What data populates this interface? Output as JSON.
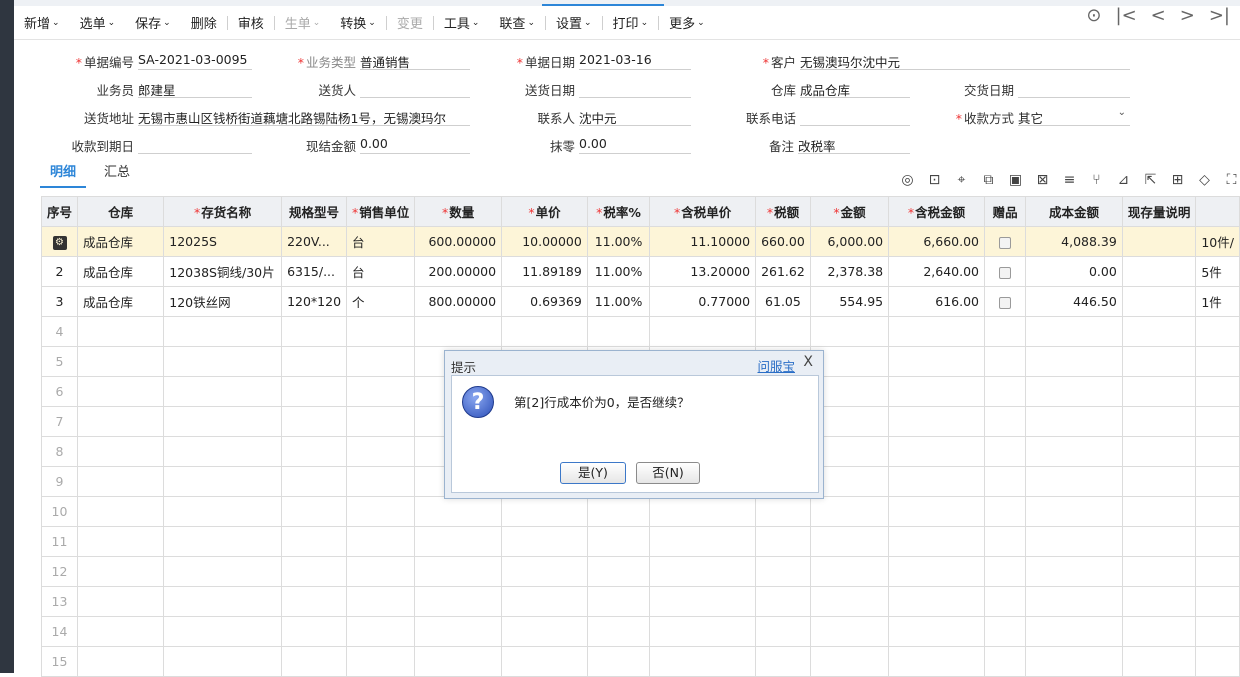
{
  "toolbar": {
    "items": [
      {
        "label": "新增",
        "caret": true
      },
      {
        "label": "选单",
        "caret": true
      },
      {
        "label": "保存",
        "caret": true
      },
      {
        "label": "删除",
        "caret": false
      },
      {
        "label": "审核",
        "caret": false
      },
      {
        "label": "生单",
        "caret": true,
        "disabled": true
      },
      {
        "label": "转换",
        "caret": true
      },
      {
        "label": "变更",
        "caret": false,
        "disabled": true
      },
      {
        "label": "工具",
        "caret": true
      },
      {
        "label": "联查",
        "caret": true
      },
      {
        "label": "设置",
        "caret": true
      },
      {
        "label": "打印",
        "caret": true
      },
      {
        "label": "更多",
        "caret": true
      }
    ],
    "caret_glyph": "⌄"
  },
  "form": {
    "doc_no_label": "单据编号",
    "doc_no": "SA-2021-03-0095",
    "biz_type_label": "业务类型",
    "biz_type": "普通销售",
    "doc_date_label": "单据日期",
    "doc_date": "2021-03-16",
    "customer_label": "客户",
    "customer": "无锡澳玛尔沈中元",
    "salesman_label": "业务员",
    "salesman": "郎建星",
    "deliverer_label": "送货人",
    "deliverer": "",
    "delivery_date_label": "送货日期",
    "delivery_date": "",
    "warehouse_label": "仓库",
    "warehouse": "成品仓库",
    "handover_date_label": "交货日期",
    "handover_date": "",
    "address_label": "送货地址",
    "address": "无锡市惠山区钱桥街道藕塘北路锡陆杨1号，无锡澳玛尔",
    "contact_label": "联系人",
    "contact": "沈中元",
    "phone_label": "联系电话",
    "phone": "",
    "payment_label": "收款方式",
    "payment": "其它",
    "due_date_label": "收款到期日",
    "due_date": "",
    "cash_label": "现结金额",
    "cash": "0.00",
    "rounding_label": "抹零",
    "rounding": "0.00",
    "remark_label": "备注",
    "remark": "改税率"
  },
  "tabs": [
    {
      "label": "明细"
    },
    {
      "label": "汇总"
    }
  ],
  "grid": {
    "headers": [
      "序号",
      "仓库",
      "存货名称",
      "规格型号",
      "销售单位",
      "数量",
      "单价",
      "税率%",
      "含税单价",
      "税额",
      "金额",
      "含税金额",
      "赠品",
      "成本金额",
      "现存量说明",
      ""
    ],
    "rows": [
      {
        "no": "",
        "wh": "成品仓库",
        "name": "12025S",
        "spec": "220V...",
        "unit": "台",
        "qty": "600.00000",
        "price": "10.00000",
        "tax": "11.00%",
        "tprice": "11.10000",
        "taxamt": "660.00",
        "amt": "6,000.00",
        "tamt": "6,660.00",
        "cost": "4,088.39",
        "stock": "",
        "extra": "10件/"
      },
      {
        "no": "2",
        "wh": "成品仓库",
        "name": "12038S铜线/30片",
        "spec": "6315/...",
        "unit": "台",
        "qty": "200.00000",
        "price": "11.89189",
        "tax": "11.00%",
        "tprice": "13.20000",
        "taxamt": "261.62",
        "amt": "2,378.38",
        "tamt": "2,640.00",
        "cost": "0.00",
        "stock": "",
        "extra": "5件"
      },
      {
        "no": "3",
        "wh": "成品仓库",
        "name": "120铁丝网",
        "spec": "120*120",
        "unit": "个",
        "qty": "800.00000",
        "price": "0.69369",
        "tax": "11.00%",
        "tprice": "0.77000",
        "taxamt": "61.05",
        "amt": "554.95",
        "tamt": "616.00",
        "cost": "446.50",
        "stock": "",
        "extra": "1件"
      }
    ],
    "empty_rows": [
      "4",
      "5",
      "6",
      "7",
      "8",
      "9",
      "10",
      "11",
      "12",
      "13",
      "14",
      "15"
    ]
  },
  "dialog": {
    "title": "提示",
    "link": "问服宝",
    "close": "X",
    "message": "第[2]行成本价为0，是否继续？",
    "yes": "是(Y)",
    "no": "否(N)"
  }
}
